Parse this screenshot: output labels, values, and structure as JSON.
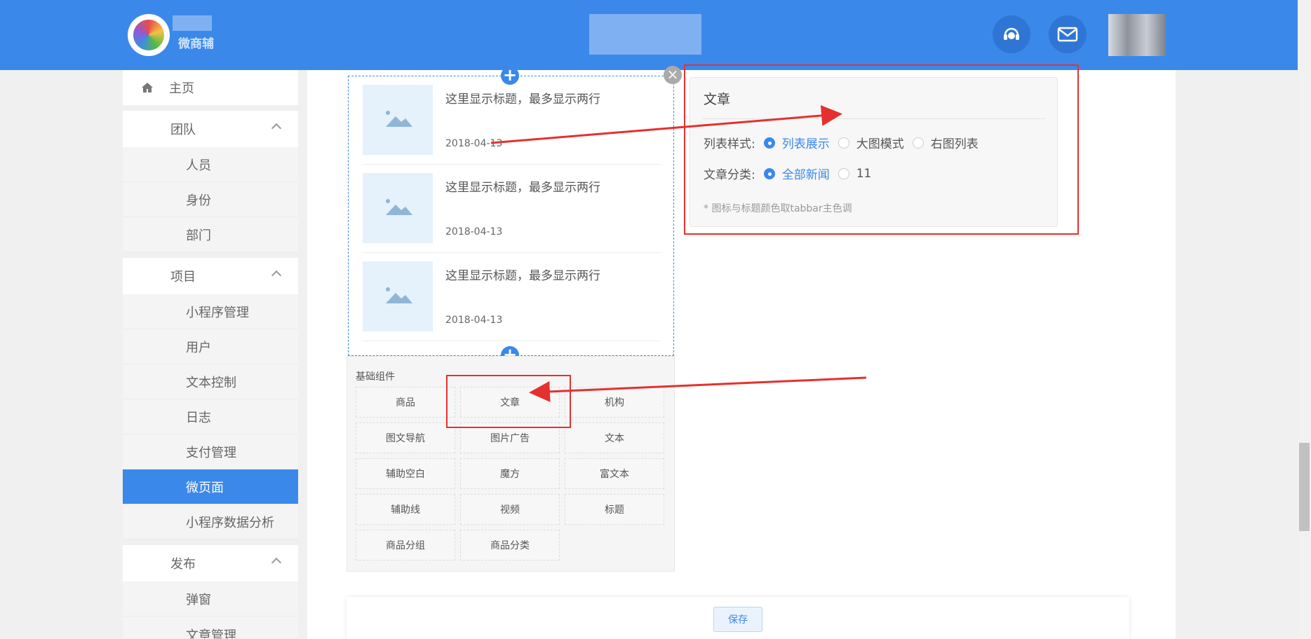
{
  "header": {
    "brand": "微商辅",
    "icons": [
      "customer-service-icon",
      "mail-icon"
    ],
    "accent": "#3b88eb"
  },
  "sidebar": {
    "home": "主页",
    "groups": [
      {
        "label": "团队",
        "items": [
          "人员",
          "身份",
          "部门"
        ]
      },
      {
        "label": "项目",
        "items": [
          "小程序管理",
          "用户",
          "文本控制",
          "日志",
          "支付管理",
          "微页面",
          "小程序数据分析"
        ]
      },
      {
        "label": "发布",
        "items": [
          "弹窗",
          "文章管理"
        ]
      }
    ],
    "active": "微页面"
  },
  "preview": {
    "articles": [
      {
        "title": "这里显示标题，最多显示两行",
        "date": "2018-04-13"
      },
      {
        "title": "这里显示标题，最多显示两行",
        "date": "2018-04-13"
      },
      {
        "title": "这里显示标题，最多显示两行",
        "date": "2018-04-13"
      }
    ]
  },
  "components": {
    "title": "基础组件",
    "items": [
      "商品",
      "文章",
      "机构",
      "图文导航",
      "图片广告",
      "文本",
      "辅助空白",
      "魔方",
      "富文本",
      "辅助线",
      "视频",
      "标题",
      "商品分组",
      "商品分类"
    ]
  },
  "settings": {
    "title": "文章",
    "list_style_label": "列表样式:",
    "list_style_options": [
      "列表展示",
      "大图模式",
      "右图列表"
    ],
    "category_label": "文章分类:",
    "category_options": [
      "全部新闻",
      "11"
    ],
    "hint": "* 图标与标题颜色取tabbar主色调"
  },
  "save_label": "保存"
}
